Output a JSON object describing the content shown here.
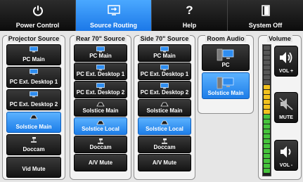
{
  "nav": {
    "items": [
      {
        "label": "Power Control",
        "icon": "power-icon"
      },
      {
        "label": "Source Routing",
        "icon": "routing-icon"
      },
      {
        "label": "Help",
        "icon": "help-icon"
      },
      {
        "label": "System Off",
        "icon": "exit-door-icon"
      }
    ],
    "active_index": 1
  },
  "projector": {
    "title": "Projector Source",
    "buttons": [
      {
        "label": "PC Main",
        "icon": "monitor-icon"
      },
      {
        "label": "PC Ext. Desktop 1",
        "icon": "monitor-icon"
      },
      {
        "label": "PC Ext. Desktop 2",
        "icon": "monitor-icon"
      },
      {
        "label": "Solstice Main",
        "icon": "solstice-icon",
        "active": true
      },
      {
        "label": "Doccam",
        "icon": "doccam-icon"
      },
      {
        "label": "Vid Mute",
        "icon": ""
      }
    ]
  },
  "rear": {
    "title": "Rear 70\" Source",
    "buttons": [
      {
        "label": "PC Main",
        "icon": "monitor-icon"
      },
      {
        "label": "PC Ext. Desktop 1",
        "icon": "monitor-icon"
      },
      {
        "label": "PC Ext. Desktop 2",
        "icon": "monitor-icon"
      },
      {
        "label": "Solstice Main",
        "icon": "solstice-icon"
      },
      {
        "label": "Solstice Local",
        "icon": "solstice-icon",
        "active": true
      },
      {
        "label": "Doccam",
        "icon": "doccam-icon"
      },
      {
        "label": "A/V Mute",
        "icon": ""
      }
    ]
  },
  "side": {
    "title": "Side 70\" Source",
    "buttons": [
      {
        "label": "PC Main",
        "icon": "monitor-icon"
      },
      {
        "label": "PC Ext. Desktop 1",
        "icon": "monitor-icon"
      },
      {
        "label": "PC Ext. Desktop 2",
        "icon": "monitor-icon"
      },
      {
        "label": "Solstice Main",
        "icon": "solstice-icon"
      },
      {
        "label": "Solstice Local",
        "icon": "solstice-icon",
        "active": true
      },
      {
        "label": "Doccam",
        "icon": "doccam-icon"
      },
      {
        "label": "A/V Mute",
        "icon": ""
      }
    ]
  },
  "audio": {
    "title": "Room Audio",
    "buttons": [
      {
        "label": "PC",
        "icon": "pc-tower-icon"
      },
      {
        "label": "Solstice Main",
        "icon": "pc-tower-icon",
        "active": true
      }
    ]
  },
  "volume": {
    "title": "Volume",
    "level_fraction": 0.7,
    "up_label": "VOL +",
    "mute_label": "MUTE",
    "down_label": "VOL -"
  },
  "colors": {
    "accent": "#1d7de8",
    "button_dark": "#141414",
    "meter_green": "#46c43c",
    "meter_yellow": "#f2c21e",
    "meter_off": "#555555"
  }
}
